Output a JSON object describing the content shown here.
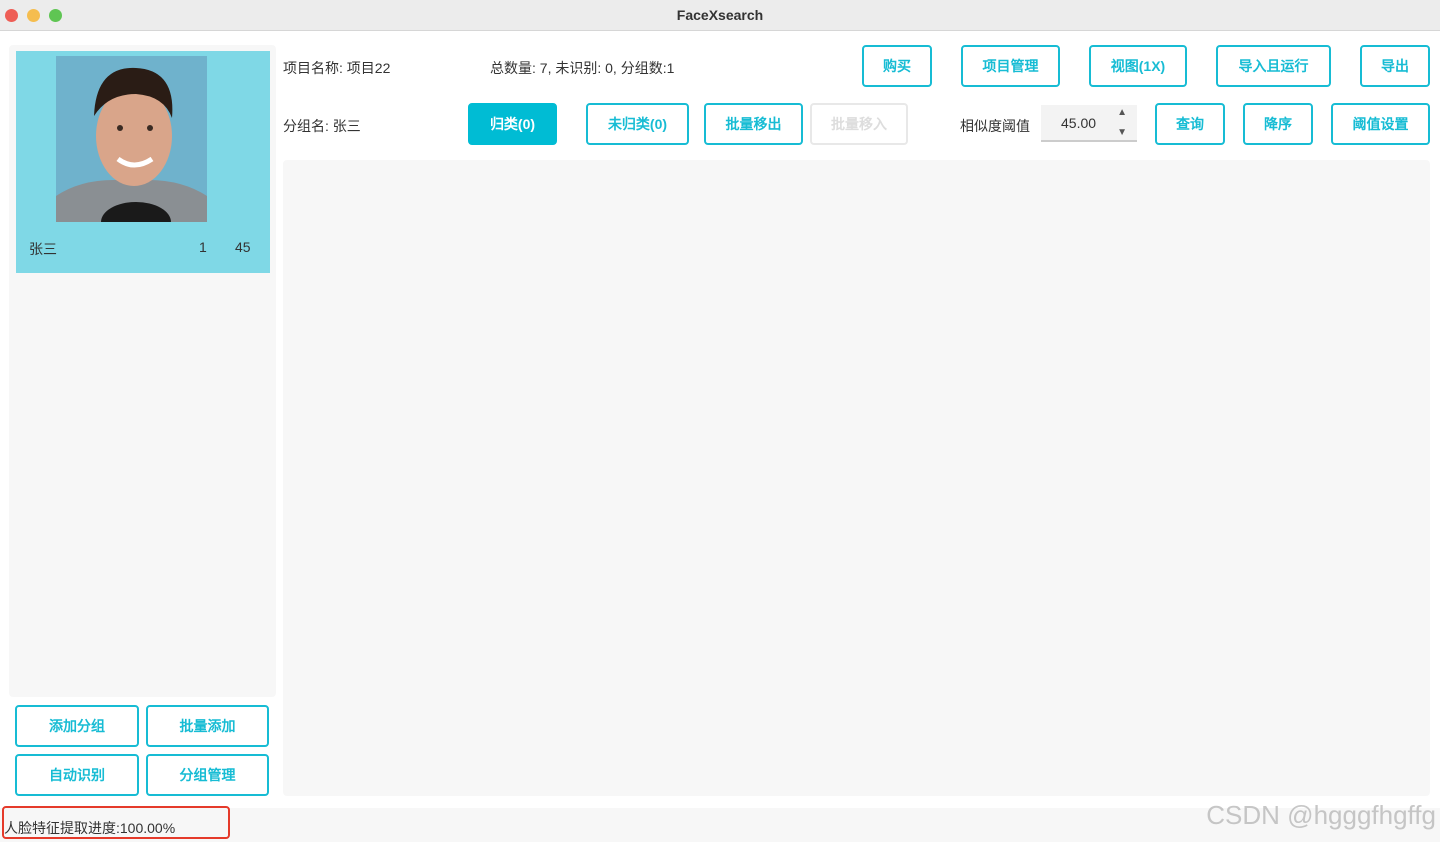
{
  "window": {
    "title": "FaceXsearch"
  },
  "sidebar": {
    "group_card": {
      "name": "张三",
      "count": "1",
      "score": "45"
    },
    "buttons": {
      "add_group": "添加分组",
      "batch_add": "批量添加",
      "auto_recognize": "自动识别",
      "group_manage": "分组管理"
    }
  },
  "header": {
    "project_name": "项目名称: 项目22",
    "stats": "总数量: 7, 未识别: 0, 分组数:1",
    "group_name": "分组名: 张三"
  },
  "toolbar": {
    "buy": "购买",
    "project_manage": "项目管理",
    "view": "视图(1X)",
    "import_run": "导入且运行",
    "export": "导出",
    "classified": "归类(0)",
    "unclassified": "未归类(0)",
    "batch_move_out": "批量移出",
    "batch_move_in": "批量移入",
    "similarity_label": "相似度阈值",
    "similarity_value": "45.00",
    "query": "查询",
    "sort_desc": "降序",
    "threshold_settings": "阈值设置"
  },
  "status": {
    "progress_text": "人脸特征提取进度:100.00%",
    "progress_percent": 100
  },
  "watermark": "CSDN @hgggfhgffg",
  "colors": {
    "accent": "#00bcd4",
    "card_bg": "#7fd8e6",
    "highlight": "#e53a2a"
  }
}
